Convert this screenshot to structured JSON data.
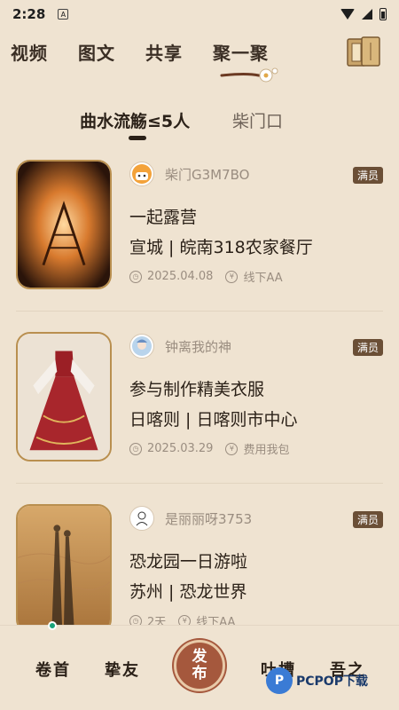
{
  "status_bar": {
    "time": "2:28",
    "app_icon": "A"
  },
  "top_nav": {
    "tabs": [
      {
        "label": "视频"
      },
      {
        "label": "图文"
      },
      {
        "label": "共享"
      },
      {
        "label": "聚一聚"
      }
    ],
    "active_index": 3
  },
  "sub_tabs": [
    {
      "label": "曲水流觞≤5人"
    },
    {
      "label": "柴门口"
    }
  ],
  "cards": [
    {
      "username": "柴门G3M7BO",
      "badge": "满员",
      "title": "一起露营",
      "location": "宣城 | 皖南318农家餐厅",
      "date": "2025.04.08",
      "fee": "线下AA"
    },
    {
      "username": "钟离我的神",
      "badge": "满员",
      "title": "参与制作精美衣服",
      "location": "日喀则 | 日喀则市中心",
      "date": "2025.03.29",
      "fee": "费用我包"
    },
    {
      "username": "是丽丽呀3753",
      "badge": "满员",
      "title": "恐龙园一日游啦",
      "location": "苏州 | 恐龙世界",
      "date": "2天",
      "fee": "线下AA"
    }
  ],
  "bottom_nav": {
    "items": [
      {
        "label": "卷首"
      },
      {
        "label": "挚友"
      },
      {
        "label": "吐槽"
      },
      {
        "label": "吾之"
      }
    ],
    "publish_line1": "发",
    "publish_line2": "布"
  },
  "watermark": {
    "text": "PCPOP下载"
  },
  "colors": {
    "background": "#efe3d1",
    "badge": "#6b4f36",
    "publish": "#a5583d",
    "frame": "#b98f4f"
  }
}
